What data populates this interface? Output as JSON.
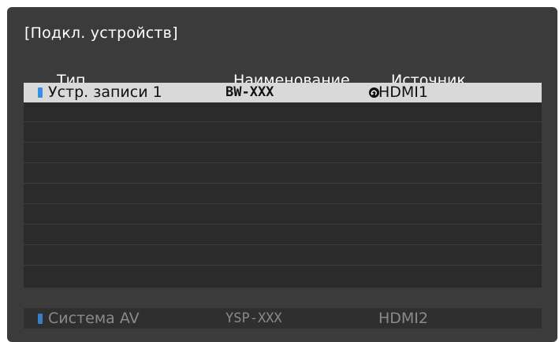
{
  "dialog": {
    "title": "[Подкл. устройств]"
  },
  "columns": {
    "type": "Тип",
    "name": "Наименование",
    "source": "Источник"
  },
  "devices": [
    {
      "type": "Устр. записи 1",
      "name": "BW-XXX",
      "source": "HDMI1",
      "selected": true,
      "icon": "device-icon",
      "source_icon": "link-icon"
    }
  ],
  "empty_rows": 9,
  "av_system": {
    "type": "Система AV",
    "name": "YSP-XXX",
    "source": "HDMI2",
    "icon": "device-icon"
  },
  "colors": {
    "panel_bg": "#3b3b3b",
    "table_bg": "#2b2b2b",
    "selected_row": "#d9d9d9",
    "device_icon": "#3a8ee0",
    "dimmed_text": "#8a8a8a"
  }
}
